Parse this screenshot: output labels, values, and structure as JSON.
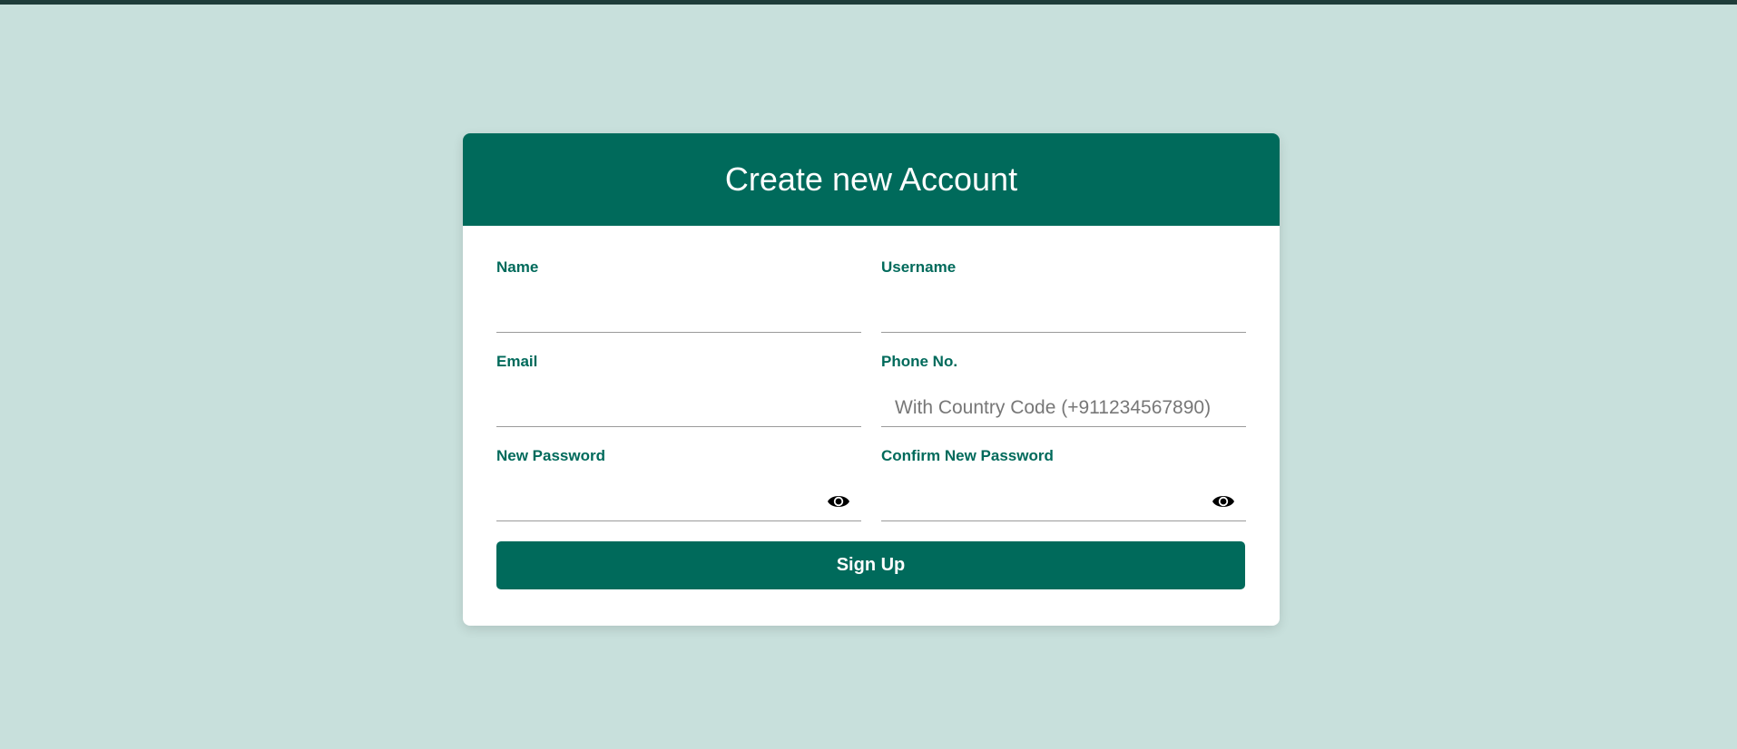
{
  "page": {
    "title": "Create new Account"
  },
  "form": {
    "name": {
      "label": "Name",
      "value": "",
      "placeholder": ""
    },
    "username": {
      "label": "Username",
      "value": "",
      "placeholder": ""
    },
    "email": {
      "label": "Email",
      "value": "",
      "placeholder": ""
    },
    "phone": {
      "label": "Phone No.",
      "value": "",
      "placeholder": "With Country Code (+911234567890)"
    },
    "new_password": {
      "label": "New Password",
      "value": "",
      "placeholder": ""
    },
    "confirm_password": {
      "label": "Confirm New Password",
      "value": "",
      "placeholder": ""
    },
    "submit_label": "Sign Up"
  },
  "colors": {
    "background": "#c8e0dc",
    "accent": "#006a5b",
    "topbar": "#1f3d3a"
  },
  "icons": {
    "password_toggle": "eye-icon"
  }
}
